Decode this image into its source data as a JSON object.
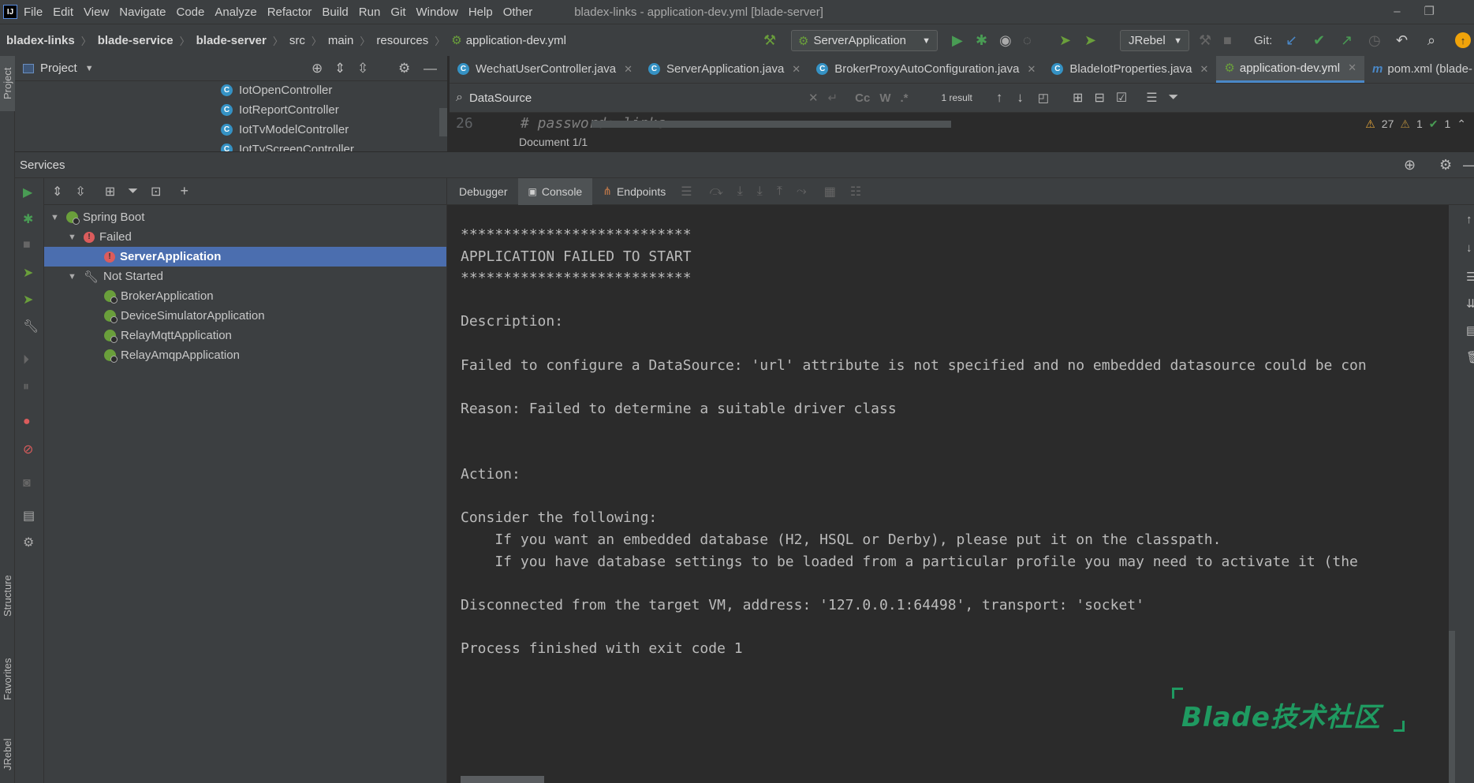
{
  "menubar": {
    "items": [
      "File",
      "Edit",
      "View",
      "Navigate",
      "Code",
      "Analyze",
      "Refactor",
      "Build",
      "Run",
      "Git",
      "Window",
      "Help",
      "Other"
    ],
    "title": "bladex-links - application-dev.yml [blade-server]"
  },
  "navbar": {
    "breadcrumbs": [
      "bladex-links",
      "blade-service",
      "blade-server",
      "src",
      "main",
      "resources",
      "application-dev.yml"
    ],
    "run_config": "ServerApplication",
    "jrebel": "JRebel",
    "git_label": "Git:"
  },
  "project": {
    "label": "Project",
    "classes": [
      "IotOpenController",
      "IotReportController",
      "IotTvModelController",
      "IotTvScreenController"
    ]
  },
  "editor_tabs": [
    "WechatUserController.java",
    "ServerApplication.java",
    "BrokerProxyAutoConfiguration.java",
    "BladeIotProperties.java",
    "application-dev.yml",
    "pom.xml (blade-"
  ],
  "search": {
    "query": "DataSource",
    "result": "1 result",
    "cc": "Cc",
    "w": "W",
    "regex": ".*"
  },
  "editor": {
    "line_number": "26",
    "line_text": "#  password: links",
    "warnings": "27",
    "weak": "1",
    "ok": "1",
    "doc_status": "Document 1/1"
  },
  "services": {
    "title": "Services",
    "tree": {
      "root": "Spring Boot",
      "failed": "Failed",
      "failed_app": "ServerApplication",
      "not_started": "Not Started",
      "apps": [
        "BrokerApplication",
        "DeviceSimulatorApplication",
        "RelayMqttApplication",
        "RelayAmqpApplication"
      ]
    }
  },
  "console_tabs": {
    "debugger": "Debugger",
    "console": "Console",
    "endpoints": "Endpoints"
  },
  "console_lines": [
    "***************************",
    "APPLICATION FAILED TO START",
    "***************************",
    "",
    "Description:",
    "",
    "Failed to configure a DataSource: 'url' attribute is not specified and no embedded datasource could be con",
    "",
    "Reason: Failed to determine a suitable driver class",
    "",
    "",
    "Action:",
    "",
    "Consider the following:",
    "    If you want an embedded database (H2, HSQL or Derby), please put it on the classpath.",
    "    If you have database settings to be loaded from a particular profile you may need to activate it (the",
    "",
    "Disconnected from the target VM, address: '127.0.0.1:64498', transport: 'socket'",
    "",
    "Process finished with exit code 1"
  ],
  "left_stripe": {
    "project": "Project",
    "structure": "Structure",
    "favorites": "Favorites",
    "jrebel": "JRebel"
  },
  "watermark": "Blade技术社区",
  "colors": {
    "accent": "#4a88c7",
    "selection": "#4b6eaf",
    "run_green": "#499c54",
    "error_red": "#db5c5c",
    "watermark_green": "#1f9a61"
  }
}
